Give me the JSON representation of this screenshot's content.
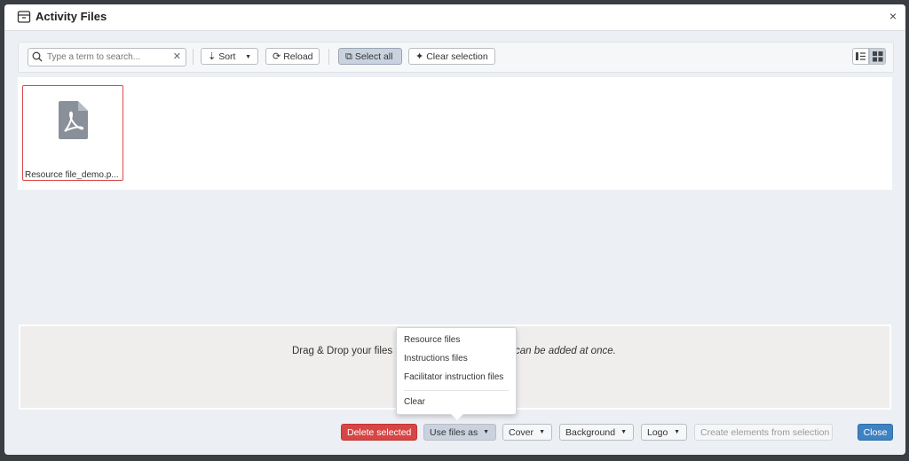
{
  "dialog": {
    "title": "Activity Files",
    "close_glyph": "×"
  },
  "toolbar": {
    "search_placeholder": "Type a term to search...",
    "sort_label": "Sort",
    "reload_label": "Reload",
    "select_all_label": "Select all",
    "clear_selection_label": "Clear selection"
  },
  "files": [
    {
      "name": "Resource file_demo.p..."
    }
  ],
  "dropzone": {
    "text_left": "Drag & Drop your files",
    "text_right": "can be added at once."
  },
  "menu": {
    "items": [
      "Resource files",
      "Instructions files",
      "Facilitator instruction files"
    ],
    "clear_label": "Clear"
  },
  "footer": {
    "delete_label": "Delete selected",
    "use_files_as_label": "Use files as",
    "cover_label": "Cover",
    "background_label": "Background",
    "logo_label": "Logo",
    "create_label": "Create elements from selection",
    "close_label": "Close"
  },
  "colors": {
    "danger": "#d84545",
    "primary": "#3f82c1",
    "selected_border": "#d84a4a"
  }
}
